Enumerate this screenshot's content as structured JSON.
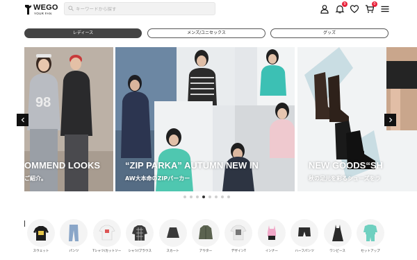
{
  "brand": {
    "name": "WEGO",
    "tagline": "YOUR FAN"
  },
  "search": {
    "placeholder": "キーワードから探す",
    "value": ""
  },
  "header_icons": {
    "account": "user-icon",
    "notifications_badge": "9",
    "favorites": "heart-icon",
    "cart_badge": "0",
    "menu": "hamburger-icon"
  },
  "categories": [
    {
      "label": "レディース",
      "active": true
    },
    {
      "label": "メンズ/ユニセックス",
      "active": false
    },
    {
      "label": "グッズ",
      "active": false
    }
  ],
  "slides": [
    {
      "title": "OMMEND LOOKS",
      "subtitle": "ご紹介。"
    },
    {
      "title": "“ZIP PARKA” AUTUMN NEW IN",
      "subtitle": "AW大本命のZIPパーカー"
    },
    {
      "title": "NEW GOODS“SH",
      "subtitle": "秋の足元を彩るシューズをラ"
    }
  ],
  "carousel": {
    "dot_count": 8,
    "active_dot": 3
  },
  "shop_categories": [
    {
      "label": "スウェット",
      "icon": "sweatshirt-icon",
      "color": "#1d1d1d"
    },
    {
      "label": "パンツ",
      "icon": "jeans-icon",
      "color": "#8aa6c8"
    },
    {
      "label": "Tシャツ/カットソー",
      "icon": "tshirt-icon",
      "color": "#f2f2f2"
    },
    {
      "label": "シャツ/ブラウス",
      "icon": "plaid-shirt-icon",
      "color": "#3b3b3b"
    },
    {
      "label": "スカート",
      "icon": "skirt-icon",
      "color": "#3a3a3a"
    },
    {
      "label": "アウター",
      "icon": "jacket-icon",
      "color": "#5b6350"
    },
    {
      "label": "デザインT",
      "icon": "graphic-tee-icon",
      "color": "#e9e9e9"
    },
    {
      "label": "インナー",
      "icon": "camisole-icon",
      "color": "#f0a8c8"
    },
    {
      "label": "ハーフパンツ",
      "icon": "shorts-icon",
      "color": "#2d2d2d"
    },
    {
      "label": "ワンピース",
      "icon": "dress-icon",
      "color": "#2a2a2a"
    },
    {
      "label": "セットアップ",
      "icon": "setup-icon",
      "color": "#6fd0c0"
    }
  ]
}
